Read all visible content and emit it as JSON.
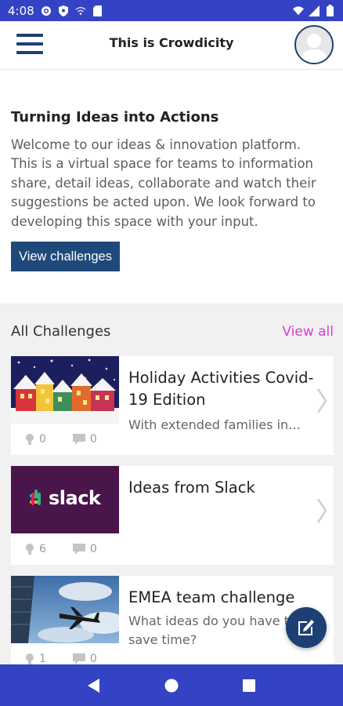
{
  "status_bar": {
    "time": "4:08"
  },
  "app_bar": {
    "title": "This is Crowdicity"
  },
  "intro": {
    "title": "Turning Ideas into Actions",
    "text": "Welcome to our ideas & innovation platform. This is a virtual space for teams to information share, detail ideas, collaborate and watch their suggestions be acted upon. We look forward to developing this space with your input.",
    "button_label": "View challenges"
  },
  "challenges": {
    "section_title": "All Challenges",
    "view_all_label": "View all",
    "items": [
      {
        "title": "Holiday Activities Covid-19 Edition",
        "subtitle": "With extended families in…",
        "ideas": "0",
        "comments": "0",
        "image": "holiday-houses"
      },
      {
        "title": "Ideas from Slack",
        "subtitle": "",
        "ideas": "6",
        "comments": "0",
        "image": "slack-logo",
        "logo_text": "slack"
      },
      {
        "title": "EMEA team challenge",
        "subtitle": "What ideas do you have to save time?",
        "ideas": "1",
        "comments": "0",
        "image": "airplane-sky"
      }
    ]
  },
  "colors": {
    "status_bar": "#3343c4",
    "brand_navy": "#1e3f73",
    "button": "#1e497a",
    "link": "#d63fd2",
    "slack_bg": "#4a154b"
  },
  "icons": {
    "menu": "hamburger-icon",
    "fab": "edit-icon",
    "nav": [
      "back-icon",
      "home-icon",
      "recents-icon"
    ]
  }
}
